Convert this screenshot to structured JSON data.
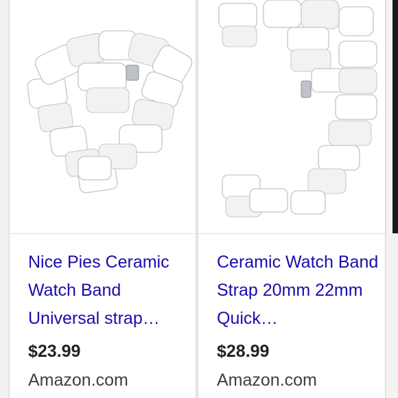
{
  "results": [
    {
      "title": "Nice Pies Ceramic Watch Band Universal strap…",
      "price": "$23.99",
      "store": "Amazon.com",
      "image": "white-ceramic-watch-band"
    },
    {
      "title": "Ceramic Watch Band Strap 20mm 22mm Quick…",
      "price": "$28.99",
      "store": "Amazon.com",
      "image": "white-ceramic-watch-band"
    }
  ],
  "colors": {
    "title_link": "#1a0dab",
    "price": "#222222",
    "store": "#3c4043",
    "background": "#ececec"
  }
}
